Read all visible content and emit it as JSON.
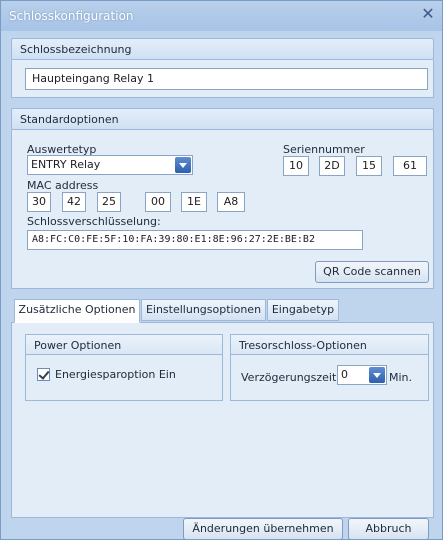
{
  "window": {
    "title": "Schlosskonfiguration",
    "close_icon": "close-icon"
  },
  "lock_name_section": {
    "header": "Schlossbezeichnung",
    "value": "Haupteingang Relay 1"
  },
  "standard_options": {
    "header": "Standardoptionen",
    "evaluation_type_label": "Auswertetyp",
    "evaluation_type_value": "ENTRY Relay",
    "serial_label": "Seriennummer",
    "serial": [
      "10",
      "2D",
      "15",
      "61"
    ],
    "mac_label": "MAC address",
    "mac": [
      "30",
      "42",
      "25",
      "00",
      "1E",
      "A8"
    ],
    "encryption_label": "Schlossverschlüsselung:",
    "encryption_value": "A8:FC:C0:FE:5F:10:FA:39:80:E1:8E:96:27:2E:BE:B2",
    "qr_button": "QR Code scannen"
  },
  "tabs": [
    "Zusätzliche Optionen",
    "Einstellungsoptionen",
    "Eingabetyp"
  ],
  "power_group": {
    "header": "Power Optionen",
    "energy_save_label": "Energiesparoption Ein",
    "energy_save_checked": true
  },
  "safe_group": {
    "header": "Tresorschloss-Optionen",
    "delay_label": "Verzögerungszeit:",
    "delay_value": "0",
    "delay_unit": "Min."
  },
  "footer": {
    "apply_button": "Änderungen übernehmen",
    "cancel_button": "Abbruch"
  }
}
